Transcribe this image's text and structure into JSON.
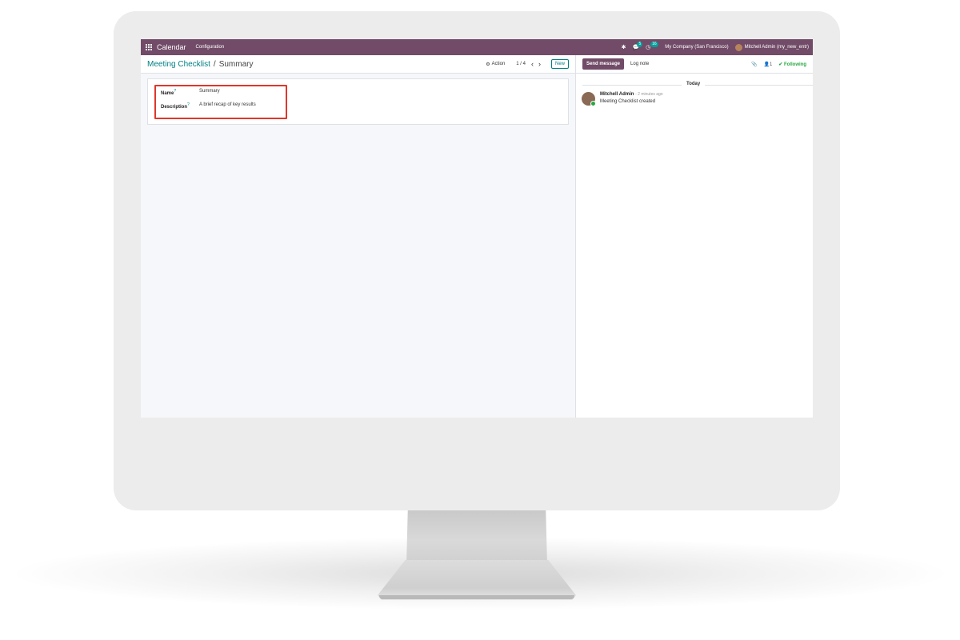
{
  "navbar": {
    "app_name": "Calendar",
    "menu": "Configuration",
    "messages_count": "5",
    "activities_count": "16",
    "company": "My Company (San Francisco)",
    "user": "Mitchell Admin (my_new_entr)"
  },
  "breadcrumb": {
    "parent": "Meeting Checklist",
    "separator": "/",
    "current": "Summary"
  },
  "control": {
    "action_label": "Action",
    "pager": "1 / 4",
    "new_label": "New"
  },
  "form": {
    "fields": [
      {
        "label": "Name",
        "help": "?",
        "value": "Summary"
      },
      {
        "label": "Description",
        "help": "?",
        "value": "A brief recap of key results"
      }
    ]
  },
  "chatter": {
    "send_message": "Send message",
    "log_note": "Log note",
    "followers_count": "1",
    "following_label": "Following",
    "date_separator": "Today",
    "messages": [
      {
        "author": "Mitchell Admin",
        "time": "- 2 minutes ago",
        "text": "Meeting Checklist created"
      }
    ]
  },
  "colors": {
    "brand": "#714B67",
    "link": "#017e84",
    "highlight": "#e0362c",
    "following": "#28a745"
  }
}
